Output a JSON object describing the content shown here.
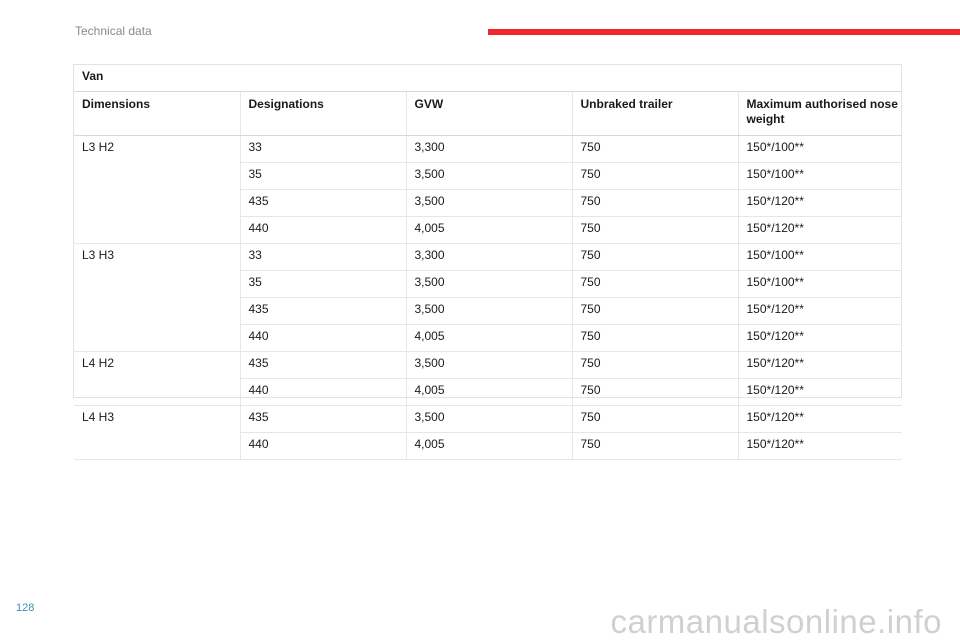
{
  "header": {
    "section_title": "Technical data",
    "accent_color": "#f2262f"
  },
  "table": {
    "title": "Van",
    "columns": [
      "Dimensions",
      "Designations",
      "GVW",
      "Unbraked trailer",
      "Maximum authorised nose weight"
    ],
    "groups": [
      {
        "dimension": "L3 H2",
        "rows": [
          [
            "33",
            "3,300",
            "750",
            "150*/100**"
          ],
          [
            "35",
            "3,500",
            "750",
            "150*/100**"
          ],
          [
            "435",
            "3,500",
            "750",
            "150*/120**"
          ],
          [
            "440",
            "4,005",
            "750",
            "150*/120**"
          ]
        ]
      },
      {
        "dimension": "L3 H3",
        "rows": [
          [
            "33",
            "3,300",
            "750",
            "150*/100**"
          ],
          [
            "35",
            "3,500",
            "750",
            "150*/100**"
          ],
          [
            "435",
            "3,500",
            "750",
            "150*/120**"
          ],
          [
            "440",
            "4,005",
            "750",
            "150*/120**"
          ]
        ]
      },
      {
        "dimension": "L4 H2",
        "rows": [
          [
            "435",
            "3,500",
            "750",
            "150*/120**"
          ],
          [
            "440",
            "4,005",
            "750",
            "150*/120**"
          ]
        ]
      },
      {
        "dimension": "L4 H3",
        "rows": [
          [
            "435",
            "3,500",
            "750",
            "150*/120**"
          ],
          [
            "440",
            "4,005",
            "750",
            "150*/120**"
          ]
        ]
      }
    ]
  },
  "footer": {
    "page_number": "128",
    "watermark": "carmanualsonline.info"
  }
}
